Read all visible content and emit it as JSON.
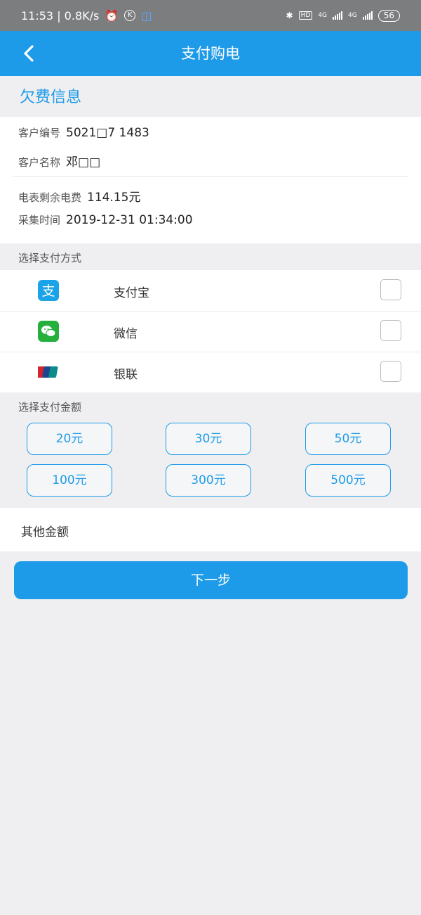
{
  "status_bar": {
    "time_speed": "11:53 | 0.8K/s",
    "k_badge": "K",
    "hd": "HD",
    "net1": "4G",
    "net2": "4G",
    "battery": "56"
  },
  "header": {
    "title": "支付购电"
  },
  "arrears": {
    "heading": "欠费信息",
    "customer_id_label": "客户编号",
    "customer_id_value": "5021□7 1483",
    "customer_name_label": "客户名称",
    "customer_name_value": "邓□□",
    "balance_label": "电表剩余电费",
    "balance_value": "114.15元",
    "collect_time_label": "采集时间",
    "collect_time_value": "2019-12-31 01:34:00"
  },
  "payment_method": {
    "label": "选择支付方式",
    "options": [
      {
        "label": "支付宝",
        "icon": "alipay-icon",
        "color": "#1aa3e8"
      },
      {
        "label": "微信",
        "icon": "wechat-icon",
        "color": "#25b03d"
      },
      {
        "label": "银联",
        "icon": "unionpay-icon",
        "color": "#d8232a"
      }
    ]
  },
  "amount": {
    "label": "选择支付金额",
    "options": [
      "20元",
      "30元",
      "50元",
      "100元",
      "300元",
      "500元"
    ],
    "other_label": "其他金额"
  },
  "actions": {
    "next_label": "下一步"
  },
  "colors": {
    "accent": "#1e9be8",
    "background": "#efeff1"
  }
}
